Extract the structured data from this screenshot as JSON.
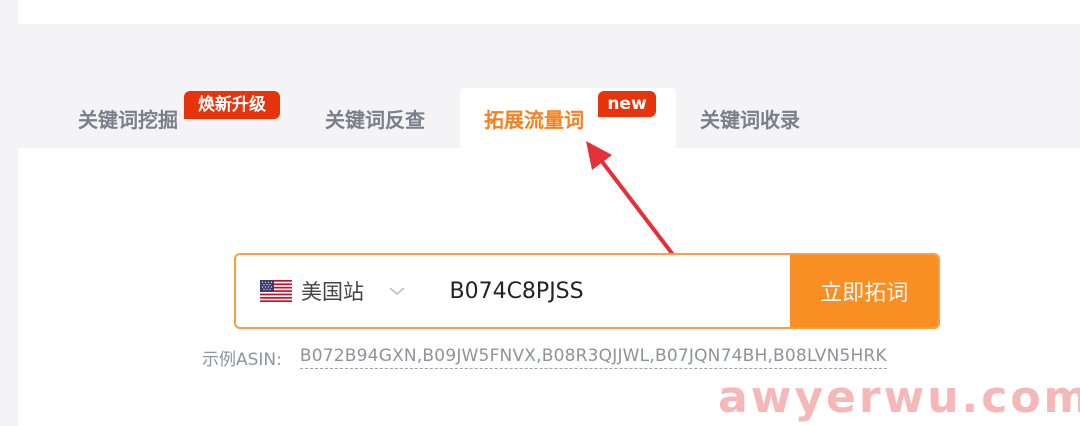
{
  "tabs": [
    {
      "label": "关键词挖掘",
      "badge": "焕新升级"
    },
    {
      "label": "关键词反查"
    },
    {
      "label": "拓展流量词",
      "badge": "new",
      "active": true
    },
    {
      "label": "关键词收录"
    }
  ],
  "search": {
    "site": {
      "label": "美国站",
      "flag": "us-flag-icon"
    },
    "value": "B074C8PJSS",
    "button_label": "立即拓词"
  },
  "example": {
    "label": "示例ASIN:",
    "values": "B072B94GXN,B09JW5FNVX,B08R3QJJWL,B07JQN74BH,B08LVN5HRK"
  },
  "watermark": "awyerwu.com",
  "colors": {
    "accent": "#f98e23",
    "badge": "#e8340c",
    "active_tab_text": "#f4811f",
    "arrow": "#e5303a"
  }
}
